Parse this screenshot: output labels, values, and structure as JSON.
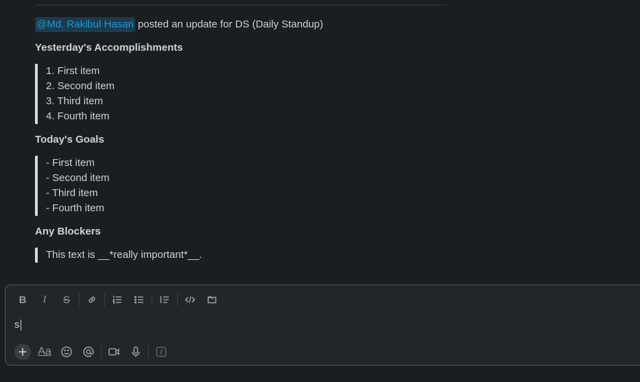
{
  "message": {
    "mention": "@Md. Rakibul Hasan",
    "intro_text": "posted an update for DS (Daily Standup)",
    "sections": [
      {
        "heading": "Yesterday's Accomplishments",
        "items": [
          "1. First item",
          "2. Second item",
          "3. Third item",
          "4. Fourth item"
        ]
      },
      {
        "heading": "Today's Goals",
        "items": [
          "- First item",
          "- Second item",
          "- Third item",
          "- Fourth item"
        ]
      },
      {
        "heading": "Any Blockers",
        "items": [
          "This text is __*really important*__."
        ]
      }
    ]
  },
  "composer": {
    "input_value": "s",
    "toolbar": {
      "bold_label": "B",
      "italic_label": "I",
      "strike_label": "S"
    },
    "formatting_label": "Aa"
  }
}
